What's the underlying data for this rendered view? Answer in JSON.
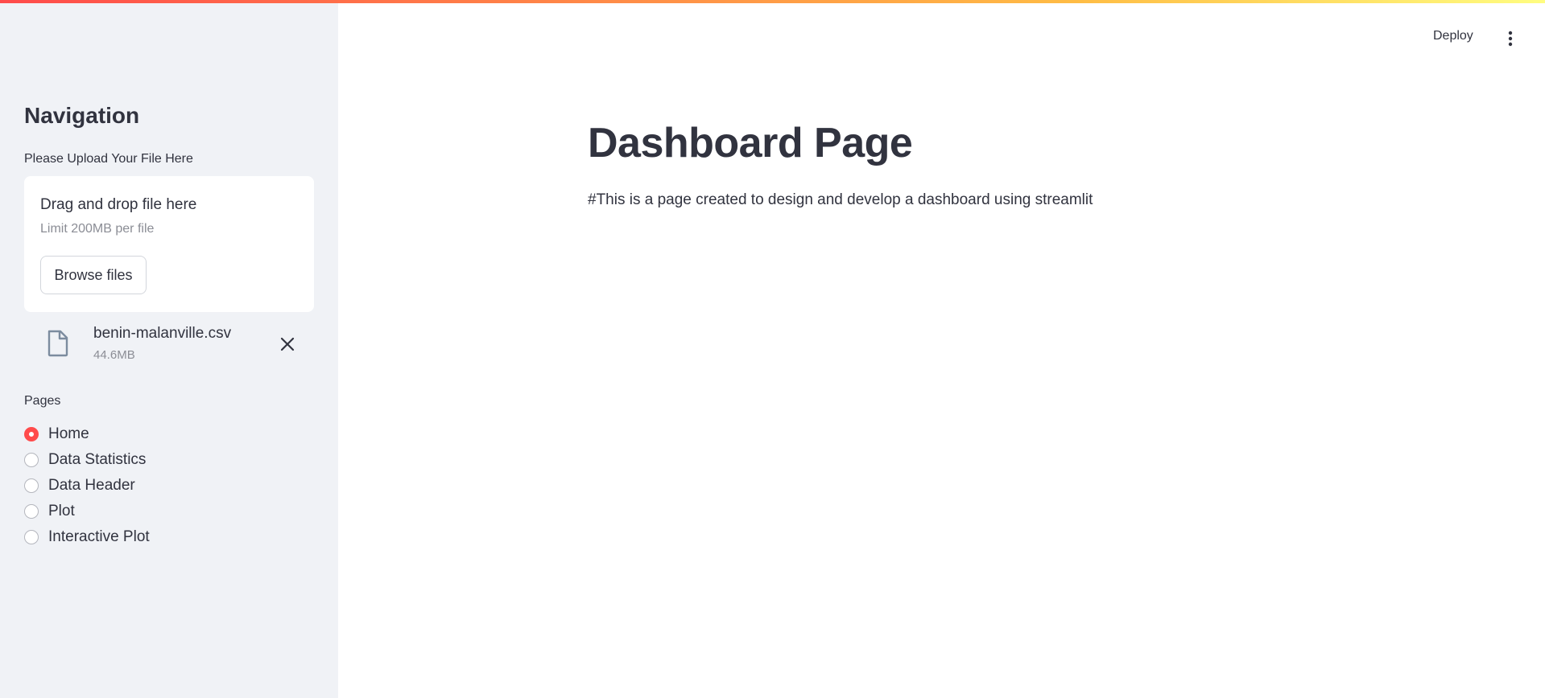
{
  "colors": {
    "accent": "#ff4b4b",
    "sidebar_bg": "#f0f2f6",
    "text": "#31333f",
    "muted": "#8b8d95"
  },
  "header": {
    "deploy_label": "Deploy",
    "menu_icon": "vertical-dots-icon"
  },
  "sidebar": {
    "title": "Navigation",
    "upload": {
      "label": "Please Upload Your File Here",
      "drop_title": "Drag and drop file here",
      "limit": "Limit 200MB per file",
      "browse_label": "Browse files"
    },
    "file": {
      "name": "benin-malanville.csv",
      "size": "44.6MB",
      "icon": "file-icon",
      "remove_icon": "close-icon"
    },
    "pages": {
      "label": "Pages",
      "selected": "Home",
      "options": [
        {
          "label": "Home",
          "checked": true
        },
        {
          "label": "Data Statistics",
          "checked": false
        },
        {
          "label": "Data Header",
          "checked": false
        },
        {
          "label": "Plot",
          "checked": false
        },
        {
          "label": "Interactive Plot",
          "checked": false
        }
      ]
    }
  },
  "main": {
    "title": "Dashboard Page",
    "description": "#This is a page created to design and develop a dashboard using streamlit"
  }
}
